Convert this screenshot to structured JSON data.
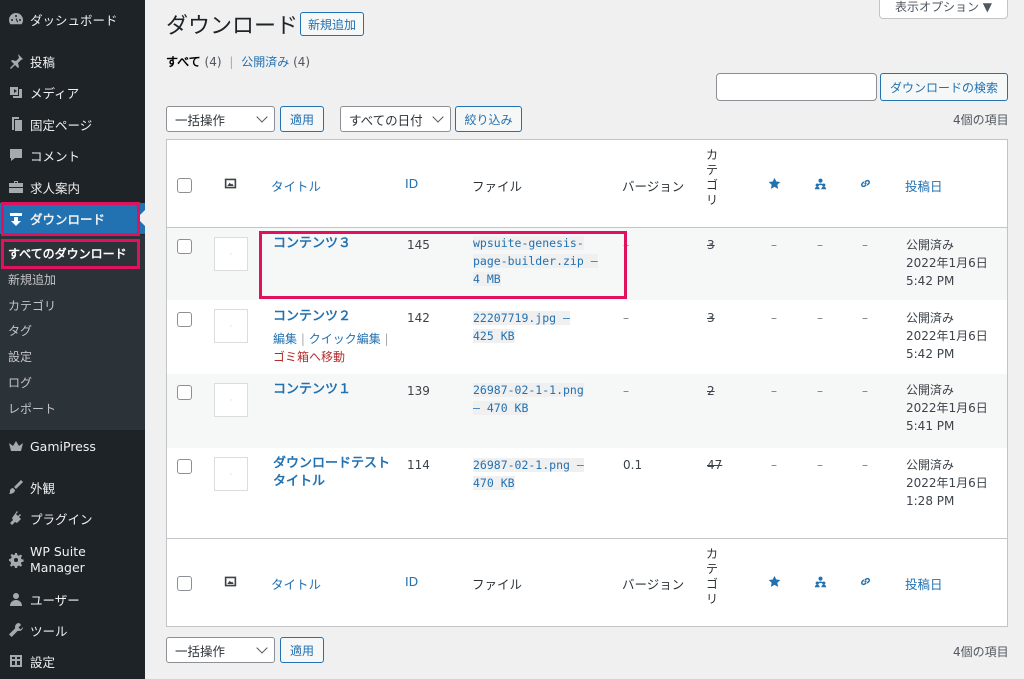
{
  "sidebar": {
    "items": [
      {
        "label": "ダッシュボード",
        "icon": "dashboard-icon"
      },
      {
        "label": "投稿",
        "icon": "pin-icon"
      },
      {
        "label": "メディア",
        "icon": "media-icon"
      },
      {
        "label": "固定ページ",
        "icon": "page-icon"
      },
      {
        "label": "コメント",
        "icon": "comment-icon"
      },
      {
        "label": "求人案内",
        "icon": "briefcase-icon"
      },
      {
        "label": "ダウンロード",
        "icon": "download-icon"
      },
      {
        "label": "GamiPress",
        "icon": "crown-icon"
      },
      {
        "label": "外観",
        "icon": "brush-icon"
      },
      {
        "label": "プラグイン",
        "icon": "plugin-icon"
      },
      {
        "label": "WP Suite\nManager",
        "icon": "gear-icon"
      },
      {
        "label": "ユーザー",
        "icon": "user-icon"
      },
      {
        "label": "ツール",
        "icon": "wrench-icon"
      },
      {
        "label": "設定",
        "icon": "settings-icon"
      }
    ],
    "submenu": [
      "すべてのダウンロード",
      "新規追加",
      "カテゴリ",
      "タグ",
      "設定",
      "ログ",
      "レポート"
    ]
  },
  "header": {
    "title": "ダウンロード",
    "add_new": "新規追加",
    "screen_options": "表示オプション ▼"
  },
  "filters": {
    "all_label": "すべて",
    "all_count": "(4)",
    "published_label": "公開済み",
    "published_count": "(4)",
    "search_button": "ダウンロードの検索",
    "search_value": "",
    "bulk_action": "一括操作",
    "apply": "適用",
    "date_filter": "すべての日付",
    "filter_button": "絞り込み",
    "item_count": "4個の項目"
  },
  "table": {
    "columns": {
      "title": "タイトル",
      "id": "ID",
      "file": "ファイル",
      "version": "バージョン",
      "category": "カテゴリ",
      "date": "投稿日"
    },
    "rows": [
      {
        "title": "コンテンツ３",
        "id": "145",
        "file": [
          "wpsuite-genesis-",
          "page-builder.zip –",
          "4 MB"
        ],
        "version": "–",
        "cat": "3",
        "d1": "–",
        "d2": "–",
        "d3": "–",
        "status": "公開済み",
        "date": "2022年1月6日",
        "time": "5:42 PM"
      },
      {
        "title": "コンテンツ２",
        "id": "142",
        "file": [
          "22207719.jpg –",
          "425 KB"
        ],
        "version": "–",
        "cat": "3",
        "d1": "–",
        "d2": "–",
        "d3": "–",
        "status": "公開済み",
        "date": "2022年1月6日",
        "time": "5:42 PM",
        "actions": {
          "edit": "編集",
          "quick_edit": "クイック編集",
          "trash": "ゴミ箱へ移動"
        }
      },
      {
        "title": "コンテンツ１",
        "id": "139",
        "file": [
          "26987-02-1-1.png",
          "– 470 KB"
        ],
        "version": "–",
        "cat": "2",
        "d1": "–",
        "d2": "–",
        "d3": "–",
        "status": "公開済み",
        "date": "2022年1月6日",
        "time": "5:41 PM"
      },
      {
        "title": [
          "ダウンロードテスト",
          "タイトル"
        ],
        "id": "114",
        "file": [
          "26987-02-1.png –",
          "470 KB"
        ],
        "version": "0.1",
        "cat": "47",
        "d1": "–",
        "d2": "–",
        "d3": "–",
        "status": "公開済み",
        "date": "2022年1月6日",
        "time": "1:28 PM"
      }
    ]
  },
  "footer": {
    "bulk_action": "一括操作",
    "apply": "適用",
    "item_count": "4個の項目"
  },
  "colors": {
    "accent": "#2271b1",
    "sidebar": "#1d2327",
    "highlight": "#e0115f"
  }
}
